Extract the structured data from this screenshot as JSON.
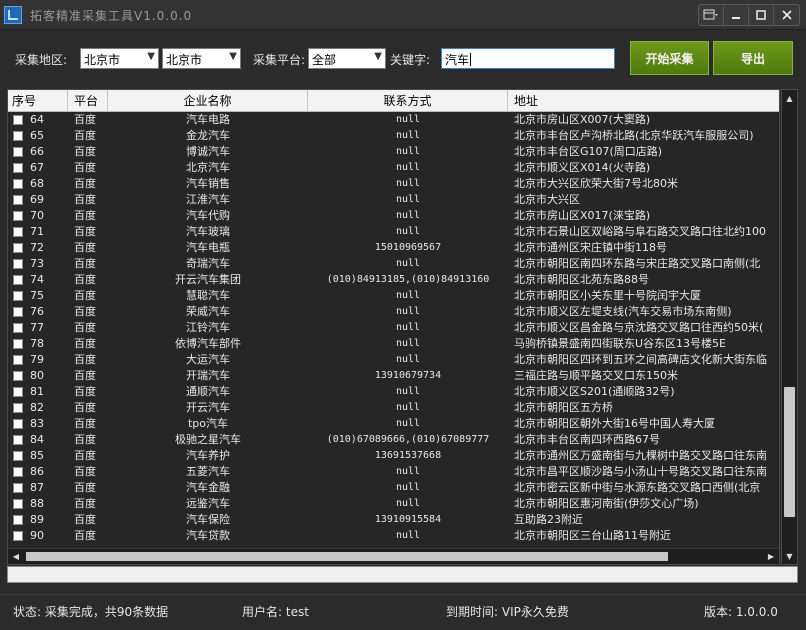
{
  "window": {
    "title": "拓客精准采集工具V1.0.0.0",
    "controls": [
      "menu-icon",
      "minimize-icon",
      "maximize-icon",
      "close-icon"
    ]
  },
  "toolbar": {
    "region_label": "采集地区:",
    "province": "北京市",
    "city": "北京市",
    "platform_label": "采集平台:",
    "platform": "全部",
    "keyword_label": "关键字:",
    "keyword": "汽车",
    "start_button": "开始采集",
    "export_button": "导出",
    "accent_color": "#5c8a14"
  },
  "table": {
    "columns": [
      "序号",
      "平台",
      "企业名称",
      "联系方式",
      "地址"
    ],
    "rows": [
      {
        "no": "64",
        "platform": "百度",
        "name": "汽车电路",
        "phone": "null",
        "address": "北京市房山区X007(大窦路)"
      },
      {
        "no": "65",
        "platform": "百度",
        "name": "金龙汽车",
        "phone": "null",
        "address": "北京市丰台区卢沟桥北路(北京华跃汽车服服公司)"
      },
      {
        "no": "66",
        "platform": "百度",
        "name": "博诚汽车",
        "phone": "null",
        "address": "北京市丰台区G107(周口店路)"
      },
      {
        "no": "67",
        "platform": "百度",
        "name": "北京汽车",
        "phone": "null",
        "address": "北京市顺义区X014(火寺路)"
      },
      {
        "no": "68",
        "platform": "百度",
        "name": "汽车销售",
        "phone": "null",
        "address": "北京市大兴区欣荣大街7号北80米"
      },
      {
        "no": "69",
        "platform": "百度",
        "name": "江淮汽车",
        "phone": "null",
        "address": "北京市大兴区"
      },
      {
        "no": "70",
        "platform": "百度",
        "name": "汽车代购",
        "phone": "null",
        "address": "北京市房山区X017(涞宝路)"
      },
      {
        "no": "71",
        "platform": "百度",
        "name": "汽车玻璃",
        "phone": "null",
        "address": "北京市石景山区双峪路与阜石路交叉路口往北约100"
      },
      {
        "no": "72",
        "platform": "百度",
        "name": "汽车电瓶",
        "phone": "15010969567",
        "address": "北京市通州区宋庄镇中街118号"
      },
      {
        "no": "73",
        "platform": "百度",
        "name": "奇瑞汽车",
        "phone": "null",
        "address": "北京市朝阳区南四环东路与宋庄路交叉路口南侧(北"
      },
      {
        "no": "74",
        "platform": "百度",
        "name": "开云汽车集团",
        "phone": "(010)84913185,(010)84913160",
        "address": "北京市朝阳区北苑东路88号"
      },
      {
        "no": "75",
        "platform": "百度",
        "name": "慧聪汽车",
        "phone": "null",
        "address": "北京市朝阳区小关东里十号院闰宇大厦"
      },
      {
        "no": "76",
        "platform": "百度",
        "name": "荣威汽车",
        "phone": "null",
        "address": "北京市顺义区左堤支线(汽车交易市场东南侧)"
      },
      {
        "no": "77",
        "platform": "百度",
        "name": "江铃汽车",
        "phone": "null",
        "address": "北京市顺义区昌金路与京沈路交叉路口往西约50米("
      },
      {
        "no": "78",
        "platform": "百度",
        "name": "依博汽车部件",
        "phone": "null",
        "address": "马驹桥镇景盛南四街联东U谷东区13号楼5E"
      },
      {
        "no": "79",
        "platform": "百度",
        "name": "大运汽车",
        "phone": "null",
        "address": "北京市朝阳区四环到五环之间高碑店文化新大街东临"
      },
      {
        "no": "80",
        "platform": "百度",
        "name": "开瑞汽车",
        "phone": "13910679734",
        "address": "三福庄路与顺平路交叉口东150米"
      },
      {
        "no": "81",
        "platform": "百度",
        "name": "通顺汽车",
        "phone": "null",
        "address": "北京市顺义区S201(通顺路32号)"
      },
      {
        "no": "82",
        "platform": "百度",
        "name": "开云汽车",
        "phone": "null",
        "address": "北京市朝阳区五方桥"
      },
      {
        "no": "83",
        "platform": "百度",
        "name": "tpo汽车",
        "phone": "null",
        "address": "北京市朝阳区朝外大街16号中国人寿大厦"
      },
      {
        "no": "84",
        "platform": "百度",
        "name": "极驰之星汽车",
        "phone": "(010)67089666,(010)67089777",
        "address": "北京市丰台区南四环西路67号"
      },
      {
        "no": "85",
        "platform": "百度",
        "name": "汽车养护",
        "phone": "13691537668",
        "address": "北京市通州区万盛南街与九棵树中路交叉路口往东南"
      },
      {
        "no": "86",
        "platform": "百度",
        "name": "五菱汽车",
        "phone": "null",
        "address": "北京市昌平区顺沙路与小汤山十号路交叉路口往东南"
      },
      {
        "no": "87",
        "platform": "百度",
        "name": "汽车金融",
        "phone": "null",
        "address": "北京市密云区新中街与水源东路交叉路口西侧(北京"
      },
      {
        "no": "88",
        "platform": "百度",
        "name": "远鉴汽车",
        "phone": "null",
        "address": "北京市朝阳区惠河南街(伊莎文心广场)"
      },
      {
        "no": "89",
        "platform": "百度",
        "name": "汽车保险",
        "phone": "13910915584",
        "address": "互助路23附近"
      },
      {
        "no": "90",
        "platform": "百度",
        "name": "汽车贷款",
        "phone": "null",
        "address": "北京市朝阳区三台山路11号附近"
      }
    ],
    "scroll_position": 0.9
  },
  "progress": {
    "fraction": 0.0
  },
  "status": {
    "state": "状态: 采集完成，共90条数据",
    "user": "用户名: test",
    "expiry": "到期时间: VIP永久免费",
    "version": "版本: 1.0.0.0"
  }
}
